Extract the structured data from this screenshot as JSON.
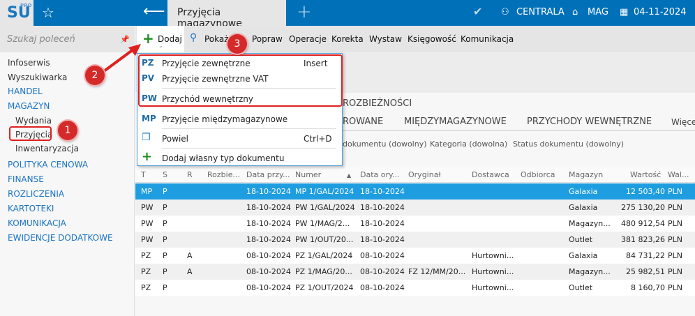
{
  "app": {
    "logo": "SU",
    "logo_sup": "PRO",
    "tab_title": "Przyjęcia magazynowe",
    "company": "CENTRALA",
    "warehouse": "MAG",
    "date": "04-11-2024"
  },
  "sidebar": {
    "search_placeholder": "Szukaj poleceń",
    "items": [
      "Infoserwis",
      "Wyszukiwarka",
      "HANDEL",
      "MAGAZYN",
      "Wydania",
      "Przyjęcia",
      "Inwentaryzacja",
      "POLITYKA CENOWA",
      "FINANSE",
      "ROZLICZENIA",
      "KARTOTEKI",
      "KOMUNIKACJA",
      "EWIDENCJE DODATKOWE"
    ]
  },
  "toolbar": {
    "dodaj": "Dodaj",
    "pokaz": "Pokaż",
    "popraw": "Popraw",
    "operacje": "Operacje",
    "korekta": "Korekta",
    "wystaw": "Wystaw",
    "ksiegowosc": "Księgowość",
    "komunikacja": "Komunikacja"
  },
  "tabs": {
    "row1": "ROZBIEŻNOŚCI",
    "row2": [
      "ROWANE",
      "MIĘDZYMAGAZYNOWE",
      "PRZYCHODY WEWNĘTRZNE",
      "Więcej"
    ]
  },
  "filters": [
    "dokumentu (dowolny)",
    "Kategoria (dowolna)",
    "Status dokumentu (dowolny)"
  ],
  "menu": [
    {
      "code": "PZ",
      "label": "Przyjęcie zewnętrzne",
      "shortcut": "Insert"
    },
    {
      "code": "PV",
      "label": "Przyjęcie zewnętrzne VAT",
      "shortcut": ""
    },
    {
      "code": "PW",
      "label": "Przychód wewnętrzny",
      "shortcut": ""
    },
    {
      "code": "MP",
      "label": "Przyjęcie międzymagazynowe",
      "shortcut": ""
    },
    {
      "code": "",
      "label": "Powiel",
      "shortcut": "Ctrl+D"
    },
    {
      "code": "",
      "label": "Dodaj własny typ dokumentu",
      "shortcut": ""
    }
  ],
  "table": {
    "columns": [
      "T",
      "S",
      "R",
      "Rozbie...",
      "Data przy...",
      "Numer",
      "Data ory...",
      "Oryginał",
      "Dostawca",
      "Odbiorca",
      "Magazyn",
      "Wartość",
      "Wal..."
    ],
    "rows": [
      [
        "MP",
        "P",
        "",
        "",
        "18-10-2024",
        "MP 1/GAL/2024",
        "18-10-2024",
        "",
        "",
        "",
        "Galaxia",
        "12 503,40",
        "PLN"
      ],
      [
        "PW",
        "P",
        "",
        "",
        "18-10-2024",
        "PW 1/GAL/2024",
        "18-10-2024",
        "",
        "",
        "",
        "Galaxia",
        "275 130,20",
        "PLN"
      ],
      [
        "PW",
        "P",
        "",
        "",
        "18-10-2024",
        "PW 1/MAG/2...",
        "18-10-2024",
        "",
        "",
        "",
        "Magazyn...",
        "480 912,54",
        "PLN"
      ],
      [
        "PW",
        "P",
        "",
        "",
        "18-10-2024",
        "PW 1/OUT/20...",
        "18-10-2024",
        "",
        "",
        "",
        "Outlet",
        "381 823,26",
        "PLN"
      ],
      [
        "PZ",
        "P",
        "A",
        "",
        "08-10-2024",
        "PZ 1/GAL/2024",
        "08-10-2024",
        "",
        "Hurtowni...",
        "",
        "Galaxia",
        "84 731,22",
        "PLN"
      ],
      [
        "PZ",
        "P",
        "A",
        "",
        "08-10-2024",
        "PZ 1/MAG/20...",
        "08-10-2024",
        "FZ 12/MM/20...",
        "Hurtowni...",
        "",
        "Magazyn...",
        "25 982,51",
        "PLN"
      ],
      [
        "PZ",
        "P",
        "",
        "",
        "08-10-2024",
        "PZ 1/OUT/2024",
        "08-10-2024",
        "",
        "Hurtowni...",
        "",
        "Outlet",
        "8 160,70",
        "PLN"
      ]
    ]
  },
  "annotations": [
    "1",
    "2",
    "3"
  ]
}
